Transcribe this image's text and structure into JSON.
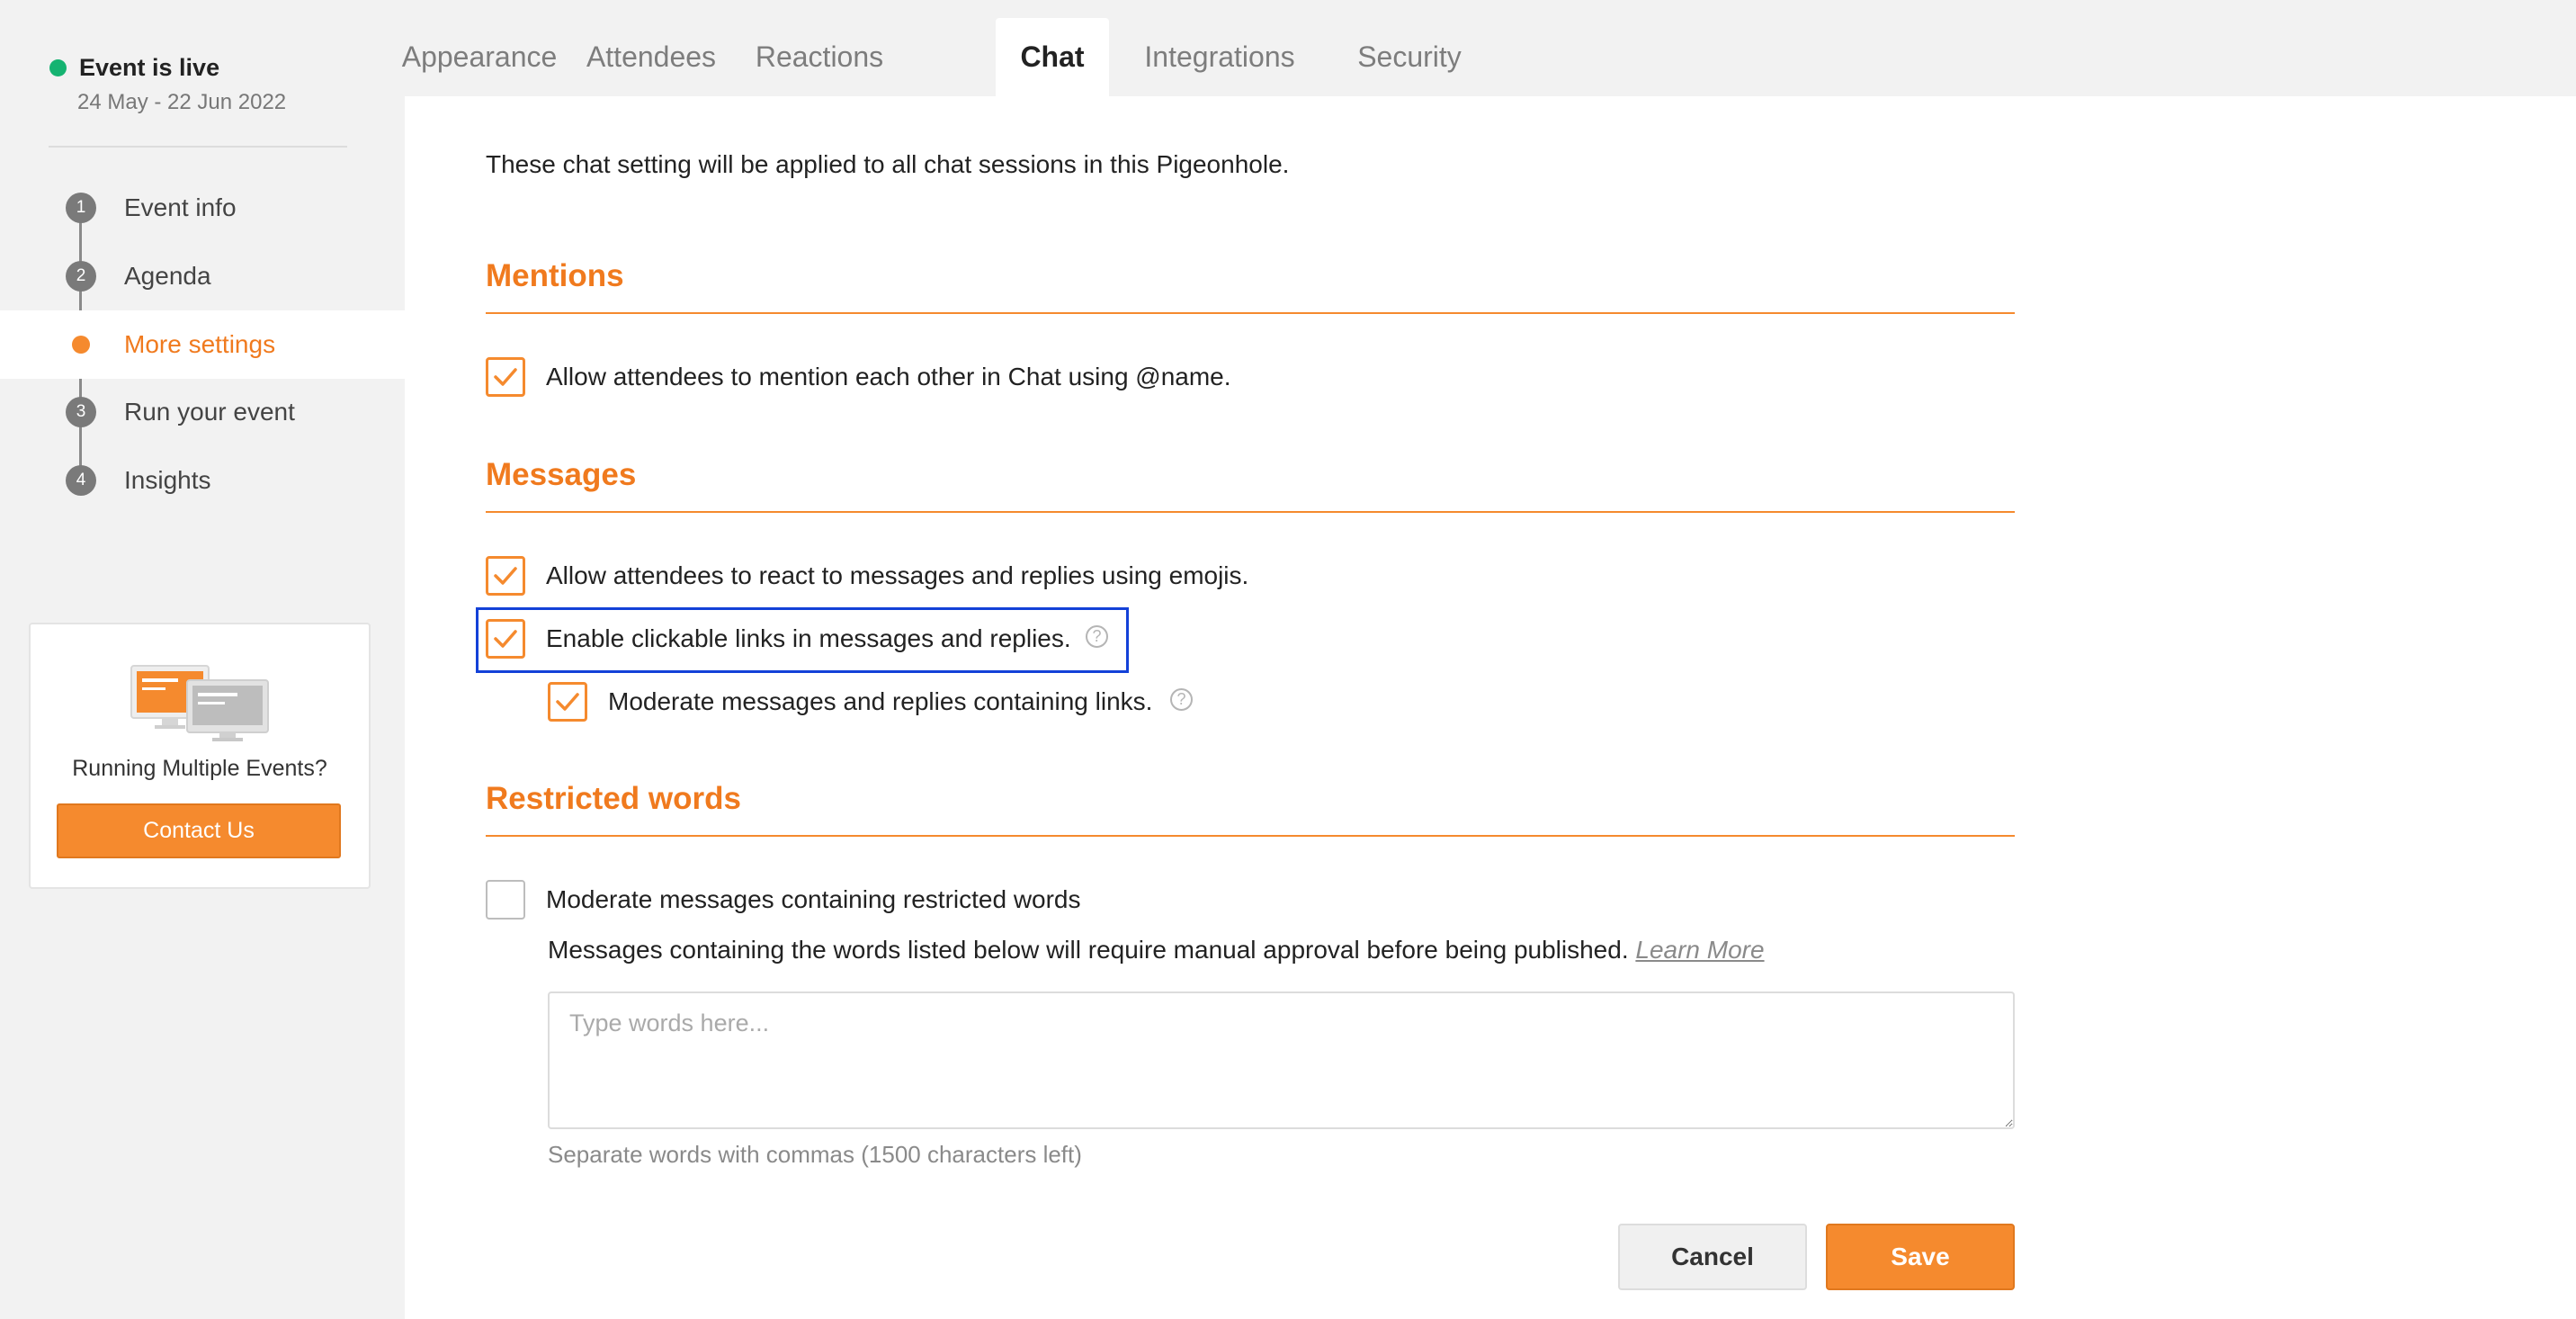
{
  "sidebar": {
    "status": {
      "label": "Event is live",
      "dates": "24 May - 22 Jun 2022",
      "color": "#15b371"
    },
    "steps": [
      {
        "number": "1",
        "label": "Event info"
      },
      {
        "number": "2",
        "label": "Agenda"
      },
      {
        "number": "",
        "label": "More settings",
        "active": true
      },
      {
        "number": "3",
        "label": "Run your event"
      },
      {
        "number": "4",
        "label": "Insights"
      }
    ],
    "promo": {
      "text": "Running Multiple Events?",
      "button": "Contact Us"
    }
  },
  "tabs": [
    {
      "label": "Appearance"
    },
    {
      "label": "Attendees"
    },
    {
      "label": "Reactions"
    },
    {
      "label": "Chat",
      "active": true
    },
    {
      "label": "Integrations"
    },
    {
      "label": "Security"
    }
  ],
  "main": {
    "intro": "These chat setting will be applied to all chat sessions in this Pigeonhole.",
    "mentions": {
      "title": "Mentions",
      "option": {
        "label": "Allow attendees to mention each other in Chat using @name.",
        "checked": true
      }
    },
    "messages": {
      "title": "Messages",
      "options": [
        {
          "label": "Allow attendees to react to messages and replies using emojis.",
          "checked": true
        },
        {
          "label": "Enable clickable links in messages and replies.",
          "checked": true,
          "focused": true
        },
        {
          "label": "Moderate messages and replies containing links.",
          "checked": true
        }
      ]
    },
    "restricted": {
      "title": "Restricted words",
      "option": {
        "label": "Moderate messages containing restricted words",
        "checked": false
      },
      "description": "Messages containing the words listed below will require manual approval before being published.",
      "learn_more": "Learn More",
      "placeholder": "Type words here...",
      "hint": "Separate words with commas (1500 characters left)"
    },
    "actions": {
      "cancel": "Cancel",
      "save": "Save"
    }
  },
  "colors": {
    "accent": "#f58a2e",
    "focus": "#1341d8"
  },
  "icons": {
    "check": "check-icon",
    "help": "question-circle-icon",
    "illustration": "monitors-illustration"
  }
}
